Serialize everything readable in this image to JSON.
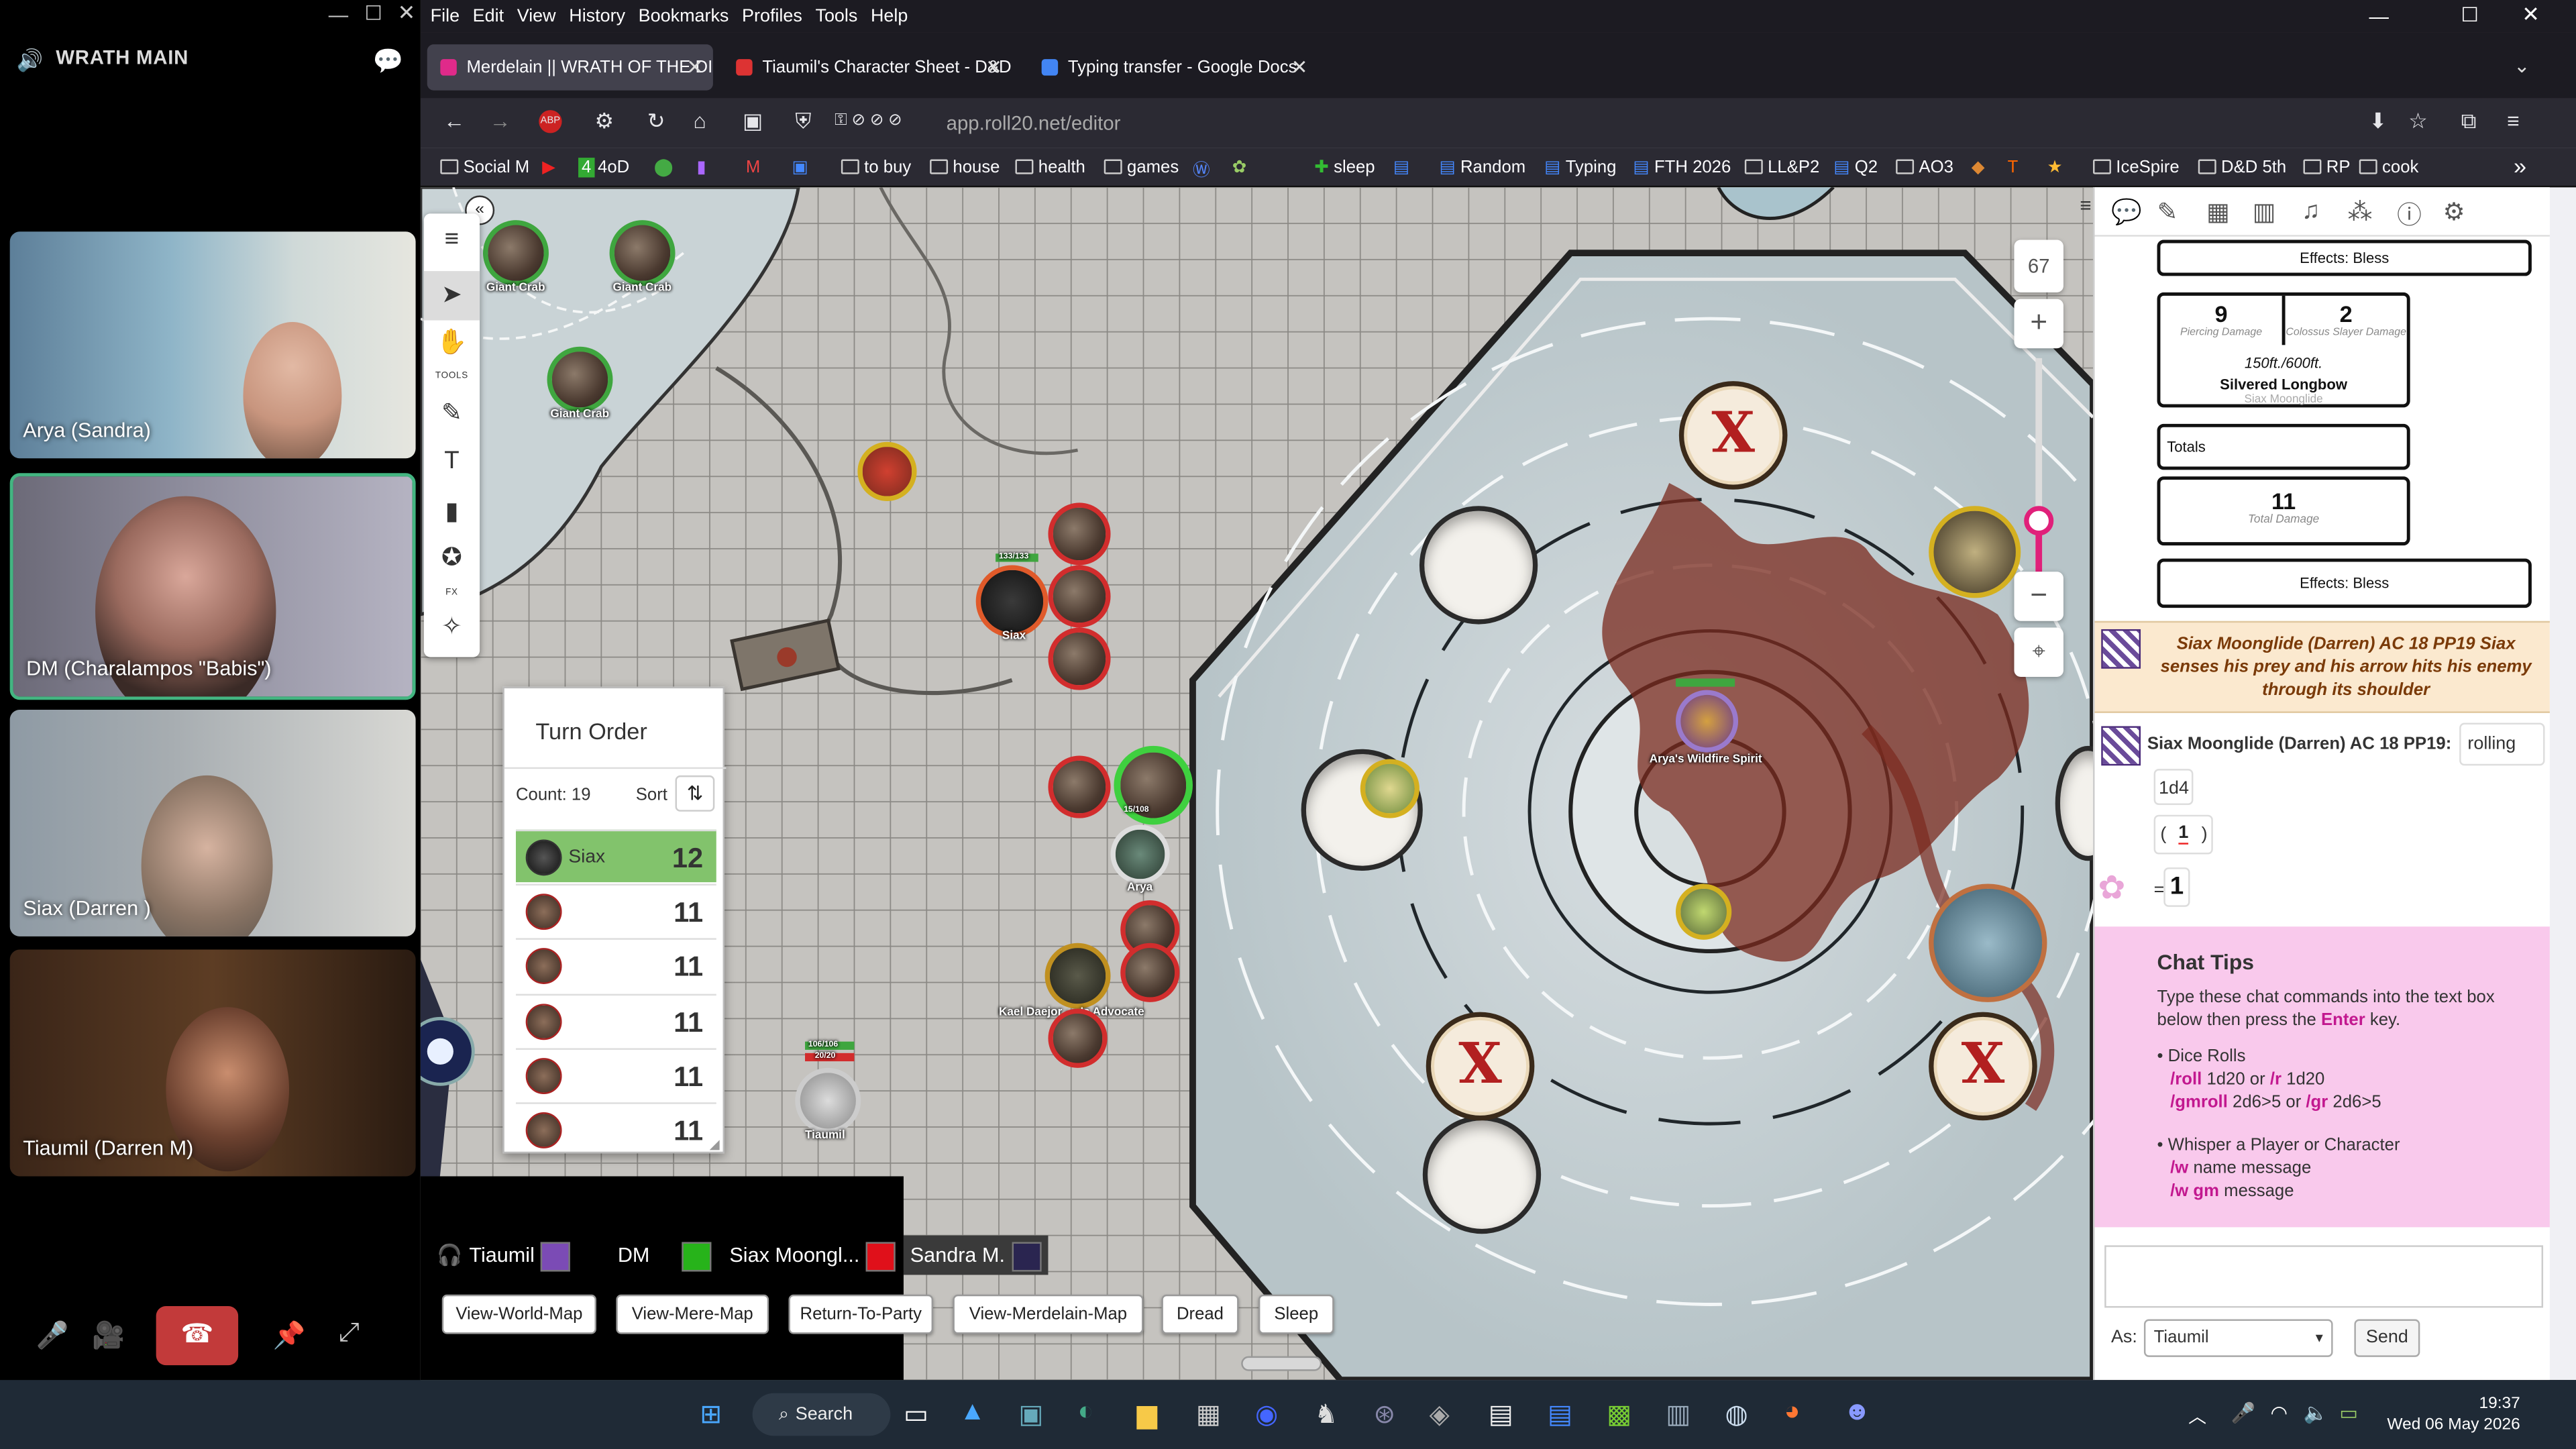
{
  "discord": {
    "channel": "WRATH MAIN",
    "tiles": [
      {
        "name": "Arya (Sandra)"
      },
      {
        "name": "DM (Charalampos \"Babis\")"
      },
      {
        "name": "Siax (Darren )"
      },
      {
        "name": "Tiaumil (Darren M)"
      }
    ]
  },
  "browser": {
    "menu": [
      "File",
      "Edit",
      "View",
      "History",
      "Bookmarks",
      "Profiles",
      "Tools",
      "Help"
    ],
    "tabs": [
      {
        "title": "Merdelain || WRATH OF THE DI",
        "color": "#e02a8a"
      },
      {
        "title": "Tiaumil's Character Sheet - D&D",
        "color": "#d33"
      },
      {
        "title": "Typing transfer - Google Docs",
        "color": "#4285f4"
      }
    ],
    "url": "app.roll20.net/editor",
    "bookmarks": [
      "Social M",
      "4oD",
      "to buy",
      "house",
      "health",
      "games",
      "sleep",
      "Random",
      "Typing",
      "FTH 2026",
      "LL&P2",
      "Q2",
      "AO3",
      "IceSpire",
      "D&D 5th",
      "RP",
      "cook"
    ]
  },
  "map": {
    "tokens": {
      "crab1": "Giant Crab",
      "crab2": "Giant Crab",
      "crab3": "Giant Crab",
      "siax": "Siax",
      "arya": "Arya",
      "kael": "Kael Daejor - ▪▪'s Advocate",
      "tiaumil": "Tiaumil",
      "spirit": "Arya's Wildfire Spirit",
      "siax_hp": "133/133",
      "arya_hp": "15/108",
      "tiaumil_hp": "106/106",
      "tiaumil_hp2": "20/20"
    },
    "x_glyph": "X"
  },
  "toolbar": {
    "tools_label": "TOOLS",
    "fx_label": "FX"
  },
  "zoom": {
    "level": "67",
    "plus": "+",
    "minus": "−"
  },
  "turn_order": {
    "title": "Turn Order",
    "count": "Count: 19",
    "sort": "Sort",
    "rows": [
      {
        "name": "Siax",
        "value": "12",
        "current": true
      },
      {
        "name": "",
        "value": "11"
      },
      {
        "name": "",
        "value": "11"
      },
      {
        "name": "",
        "value": "11"
      },
      {
        "name": "",
        "value": "11"
      },
      {
        "name": "",
        "value": "11"
      }
    ]
  },
  "players": [
    {
      "name": "Tiaumil",
      "color": "#7b4bb5"
    },
    {
      "name": "DM",
      "color": "#27b31a"
    },
    {
      "name": "Siax Moongl...",
      "color": "#e0101a"
    },
    {
      "name": "Sandra M.",
      "color": "#2a2550"
    }
  ],
  "macros": [
    "View-World-Map",
    "View-Mere-Map",
    "Return-To-Party",
    "View-Merdelain-Map",
    "Dread",
    "Sleep"
  ],
  "chat": {
    "effects1": "Effects: Bless",
    "dmg_piercing": "9",
    "dmg_piercing_label": "Piercing Damage",
    "dmg_colossus": "2",
    "dmg_colossus_label": "Colossus Slayer Damage",
    "range": "150ft./600ft.",
    "weapon": "Silvered Longbow",
    "weapon_owner": "Siax Moonglide",
    "totals": "Totals",
    "total_damage": "11",
    "total_damage_label": "Total Damage",
    "effects2": "Effects: Bless",
    "emote": "Siax Moonglide (Darren) AC 18 PP19 Siax senses his prey and his arrow hits his enemy through its shoulder",
    "roll_speaker": "Siax Moonglide (Darren) AC 18 PP19:",
    "roll_text": "rolling",
    "roll_formula": "1d4",
    "roll_open": "(",
    "roll_die": "1",
    "roll_close": ")",
    "roll_eq": "=",
    "roll_result": "1"
  },
  "chat_tips": {
    "title": "Chat Tips",
    "line1": "Type these chat commands into the text box",
    "line2a": "below then press the ",
    "line2b": "Enter",
    "line2c": " key.",
    "dice": "• Dice Rolls",
    "roll_cmd": "/roll",
    "roll_rest": " 1d20 or ",
    "r_cmd": "/r",
    "r_rest": " 1d20",
    "gmroll_cmd": "/gmroll",
    "gmroll_rest": " 2d6>5 or ",
    "gr_cmd": "/gr",
    "gr_rest": " 2d6>5",
    "whisper": "• Whisper a Player or Character",
    "w_cmd": "/w",
    "w_rest": " name message",
    "wgm_cmd": "/w gm",
    "wgm_rest": " message"
  },
  "chat_input": {
    "as_label": "As:",
    "as_value": "Tiaumil",
    "send": "Send"
  },
  "taskbar": {
    "search": "Search",
    "time": "19:37",
    "date": "Wed 06 May 2026"
  }
}
